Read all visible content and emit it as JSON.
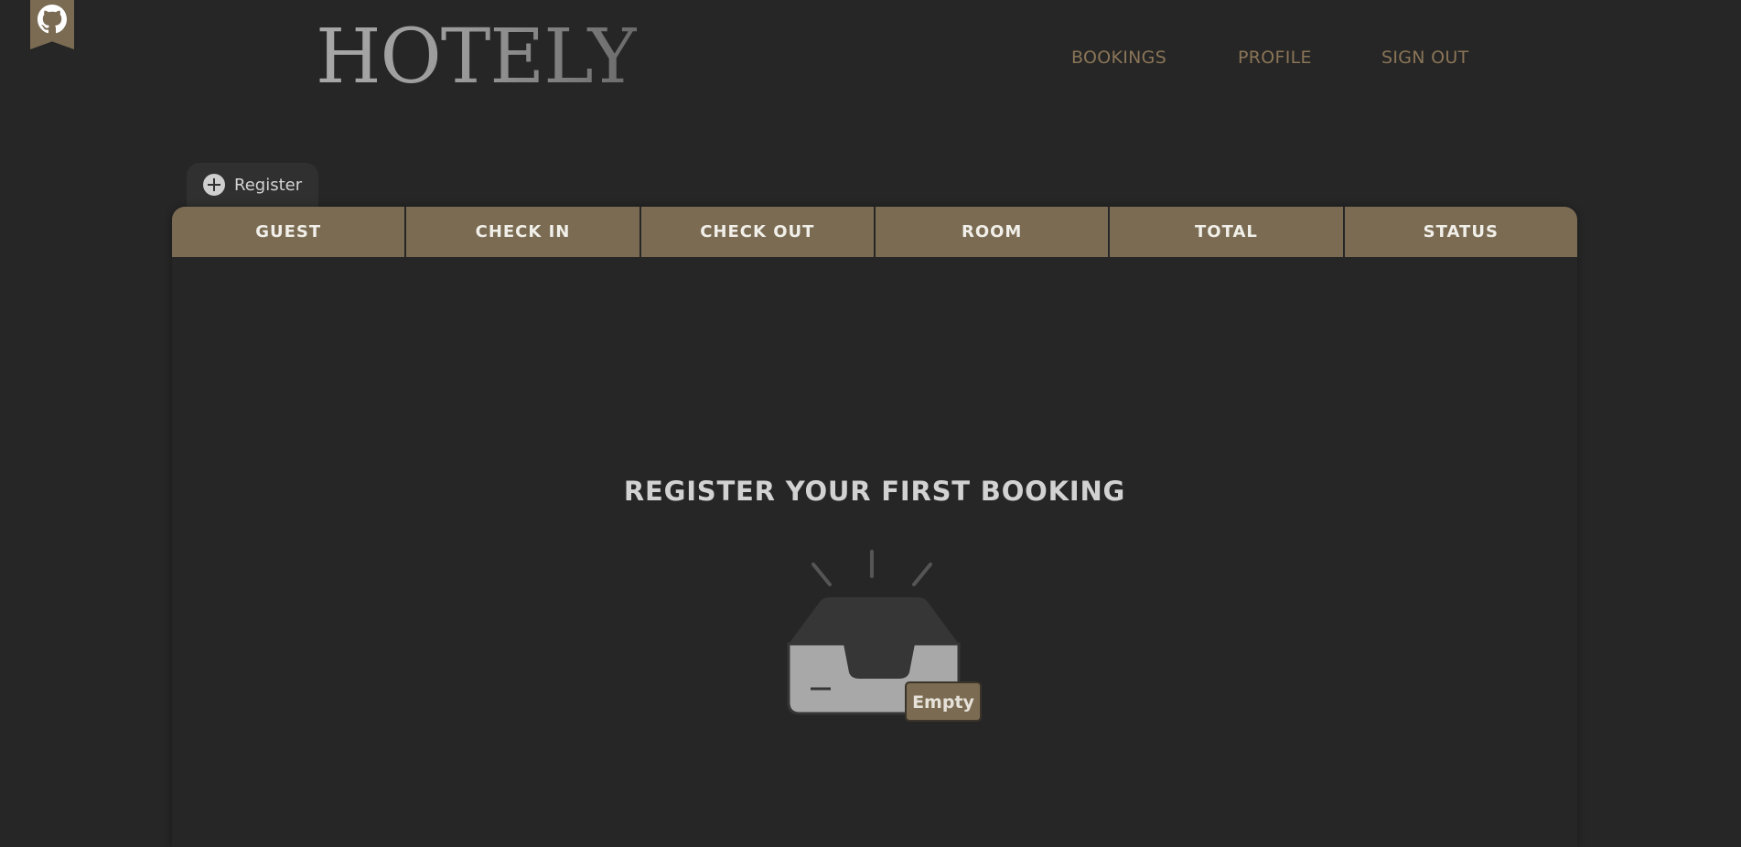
{
  "brand": {
    "logo_text": "HOTELY"
  },
  "nav": {
    "bookings": "BOOKINGS",
    "profile": "PROFILE",
    "sign_out": "SIGN OUT"
  },
  "register_tab": {
    "label": "Register"
  },
  "table": {
    "columns": [
      "GUEST",
      "CHECK IN",
      "CHECK OUT",
      "ROOM",
      "TOTAL",
      "STATUS"
    ]
  },
  "empty_state": {
    "title": "REGISTER YOUR FIRST BOOKING",
    "badge": "Empty"
  },
  "icons": {
    "ribbon": "github-icon",
    "register": "plus-circle-icon",
    "empty": "inbox-tray-icon"
  },
  "colors": {
    "background": "#262626",
    "accent": "#7a6b52",
    "nav_text": "#8a7557",
    "header_text": "#f1efe9",
    "title_text": "#d2d2d2"
  }
}
